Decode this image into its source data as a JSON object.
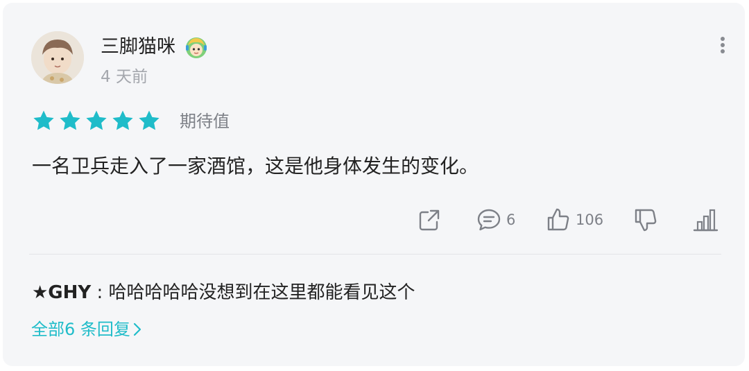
{
  "post": {
    "username": "三脚猫咪",
    "time": "4 天前",
    "rating": 5,
    "rating_label": "期待值",
    "content": "一名卫兵走入了一家酒馆，这是他身体发生的变化。"
  },
  "actions": {
    "comment_count": "6",
    "like_count": "106"
  },
  "reply": {
    "author": "★GHY",
    "separator": " : ",
    "text": "哈哈哈哈哈没想到在这里都能看见这个"
  },
  "view_all": "全部6 条回复",
  "colors": {
    "accent": "#1fbcc9",
    "icon": "#7d8087",
    "card_bg": "#f5f6f8"
  }
}
